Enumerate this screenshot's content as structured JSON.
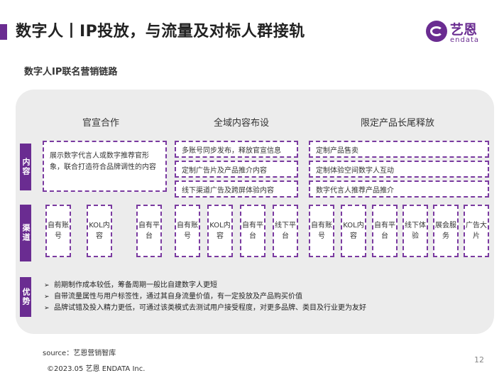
{
  "header": {
    "title": "数字人丨IP投放，与流量及对标人群接轨",
    "logo_cn": "艺恩",
    "logo_en": "endata"
  },
  "subtitle": "数字人IP联名营销链路",
  "columns": [
    "官宣合作",
    "全域内容布设",
    "限定产品长尾释放"
  ],
  "side_tabs": {
    "content": "内容",
    "channel": "渠道",
    "advantage": "优势"
  },
  "content": {
    "announce": "展示数字代言人或数字推荐官形象，联合打造符合品牌调性的内容",
    "omni": [
      "多账号同步发布，释放官宣信息",
      "定制广告片及产品推介内容",
      "线下渠道广告及跨屏体验内容"
    ],
    "limited": [
      "定制产品售卖",
      "定制体验空间数字人互动",
      "数字代言人推荐产品推介"
    ]
  },
  "channels": {
    "announce": [
      "自有账号",
      "KOL内容",
      "自有平台"
    ],
    "omni": [
      "自有账号",
      "KOL内容",
      "自有平台",
      "线下平台"
    ],
    "limited": [
      "自有账号",
      "KOL内容",
      "自有平台",
      "线下体验",
      "展会服务",
      "广告大片"
    ]
  },
  "advantages": [
    "前期制作成本较低，筹备周期一般比自建数字人更短",
    "自带流量属性与用户标签性，通过其自身流量价值，有一定投放及产品购买价值",
    "品牌试错及投入精力更低，可通过该类模式去测试用户接受程度，对更多品牌、类目及行业更为友好"
  ],
  "footer": {
    "source": "source：艺恩营销智库",
    "copyright": "©2023.05 艺恩 ENDATA Inc.",
    "page": "12"
  },
  "colors": {
    "accent": "#6a2c91",
    "panel": "#ececec"
  }
}
